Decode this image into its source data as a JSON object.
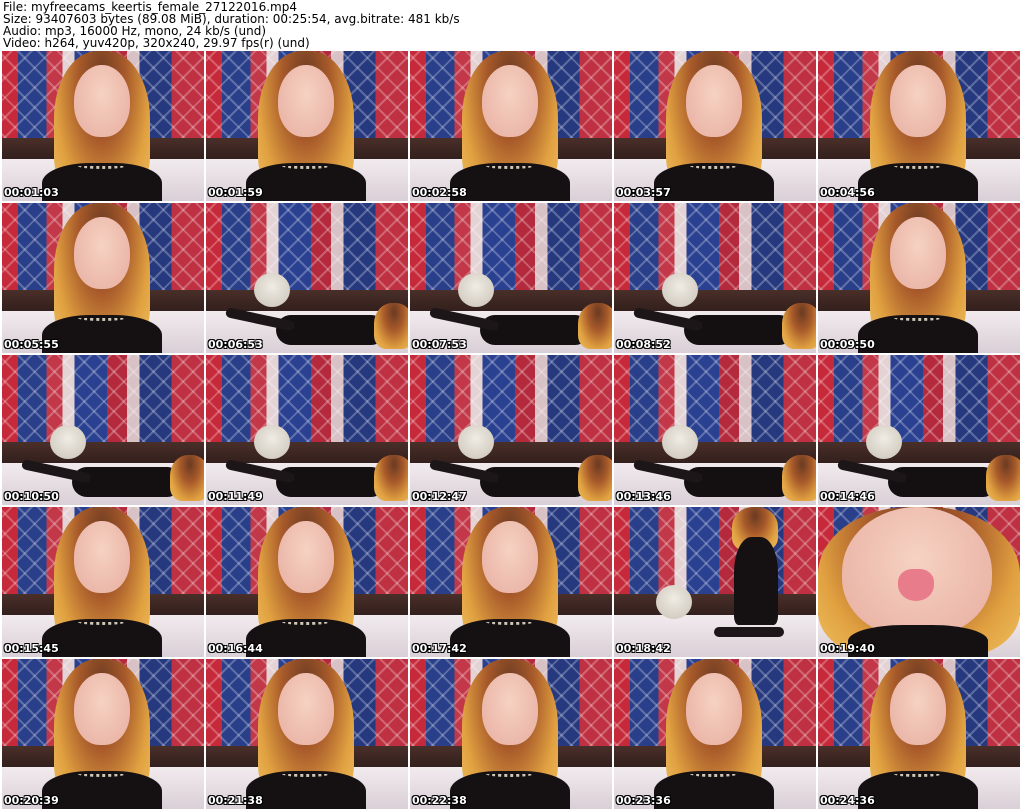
{
  "header": {
    "file_line": "File: myfreecams_keertis_female_27122016.mp4",
    "size_line": "Size: 93407603 bytes (89.08 MiB), duration: 00:25:54, avg.bitrate: 481 kb/s",
    "audio_line": "Audio: mp3, 16000 Hz, mono, 24 kb/s (und)",
    "video_line": "Video: h264, yuv420p, 320x240, 29.97 fps(r) (und)"
  },
  "thumbnails": [
    {
      "time": "00:01:03",
      "scene": "portrait"
    },
    {
      "time": "00:01:59",
      "scene": "portrait"
    },
    {
      "time": "00:02:58",
      "scene": "portrait"
    },
    {
      "time": "00:03:57",
      "scene": "portrait"
    },
    {
      "time": "00:04:56",
      "scene": "portrait"
    },
    {
      "time": "00:05:55",
      "scene": "portrait"
    },
    {
      "time": "00:06:53",
      "scene": "lying"
    },
    {
      "time": "00:07:53",
      "scene": "lying"
    },
    {
      "time": "00:08:52",
      "scene": "lying"
    },
    {
      "time": "00:09:50",
      "scene": "portrait"
    },
    {
      "time": "00:10:50",
      "scene": "lying"
    },
    {
      "time": "00:11:49",
      "scene": "lying"
    },
    {
      "time": "00:12:47",
      "scene": "lying"
    },
    {
      "time": "00:13:46",
      "scene": "lying"
    },
    {
      "time": "00:14:46",
      "scene": "lying"
    },
    {
      "time": "00:15:45",
      "scene": "portrait"
    },
    {
      "time": "00:16:44",
      "scene": "portrait"
    },
    {
      "time": "00:17:42",
      "scene": "portrait"
    },
    {
      "time": "00:18:42",
      "scene": "standing"
    },
    {
      "time": "00:19:40",
      "scene": "closeup"
    },
    {
      "time": "00:20:39",
      "scene": "portrait"
    },
    {
      "time": "00:21:38",
      "scene": "portrait"
    },
    {
      "time": "00:22:38",
      "scene": "portrait"
    },
    {
      "time": "00:23:36",
      "scene": "portrait"
    },
    {
      "time": "00:24:36",
      "scene": "portrait"
    }
  ]
}
